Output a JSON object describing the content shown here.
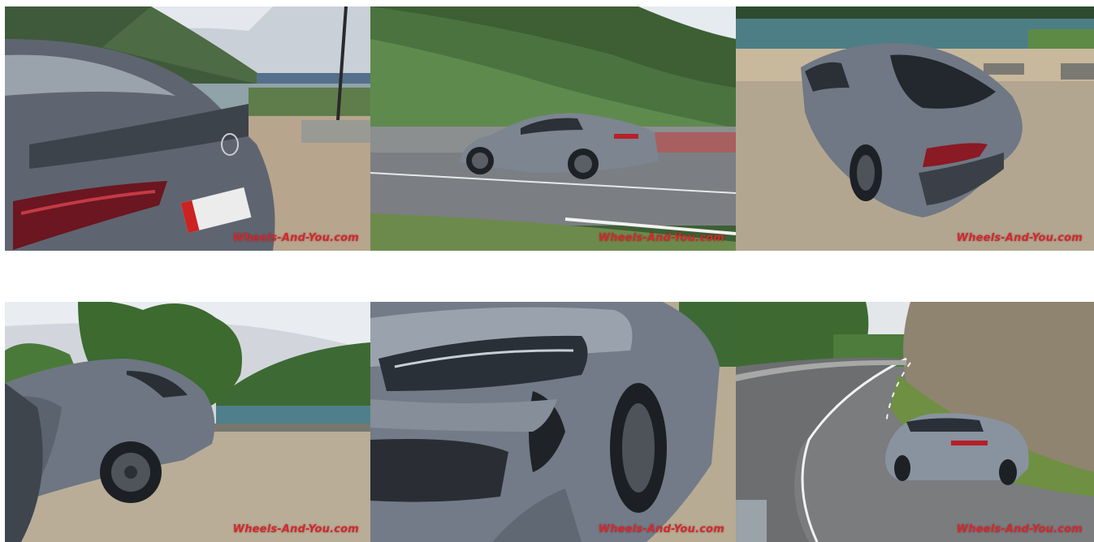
{
  "gallery": {
    "watermark": "Wheels-And-You.com",
    "photos": [
      {
        "alt": "",
        "icon": "photo-rear-detail"
      },
      {
        "alt": "",
        "icon": "photo-driving-side"
      },
      {
        "alt": "",
        "icon": "photo-rear-three-quarter"
      },
      {
        "alt": "",
        "icon": "photo-side-lake"
      },
      {
        "alt": "",
        "icon": "photo-front-headlight"
      },
      {
        "alt": "",
        "icon": "photo-mountain-road"
      }
    ]
  },
  "colors": {
    "background": "#ffffff",
    "watermark": "#d8262c",
    "car_body": "#7c8590"
  }
}
